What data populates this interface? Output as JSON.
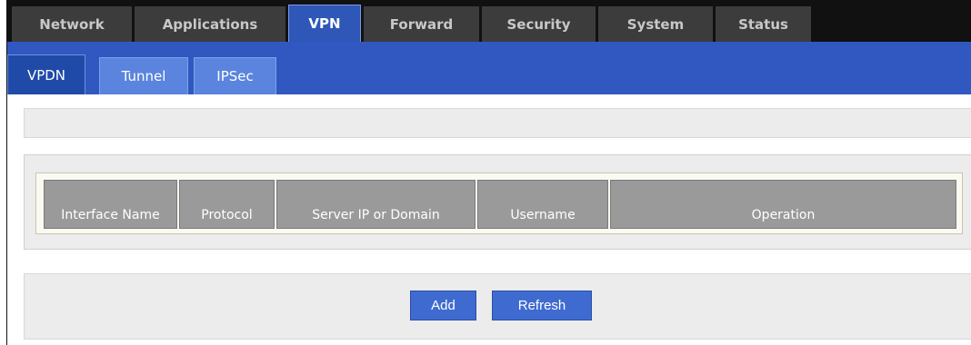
{
  "top_nav": {
    "tabs": [
      "Network",
      "Applications",
      "VPN",
      "Forward",
      "Security",
      "System",
      "Status"
    ],
    "active": "VPN"
  },
  "sub_nav": {
    "tabs": [
      "VPDN",
      "Tunnel",
      "IPSec"
    ],
    "active": "VPDN"
  },
  "table": {
    "headers": [
      "Interface Name",
      "Protocol",
      "Server IP or Domain",
      "Username",
      "Operation"
    ]
  },
  "actions": {
    "add_label": "Add",
    "refresh_label": "Refresh"
  },
  "colors": {
    "accent": "#3158c0",
    "top_nav_bg": "#111111",
    "header_cell": "#9a9a9a"
  }
}
